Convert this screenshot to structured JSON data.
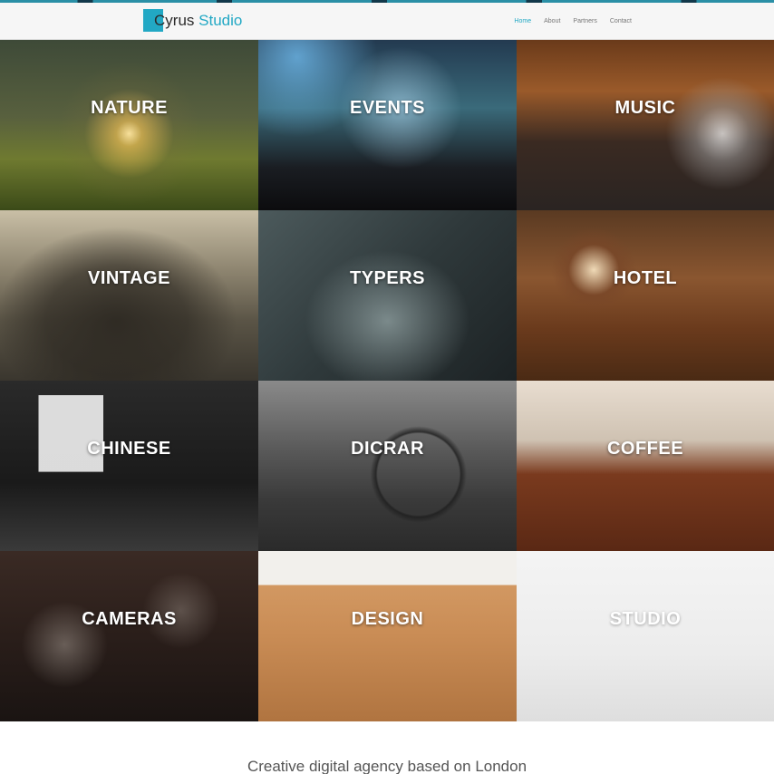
{
  "brand": {
    "name_first": "Cyrus",
    "name_second": "Studio",
    "accent_color": "#22a8c4"
  },
  "nav": {
    "items": [
      {
        "label": "Home",
        "active": true
      },
      {
        "label": "About",
        "active": false
      },
      {
        "label": "Partners",
        "active": false
      },
      {
        "label": "Contact",
        "active": false
      }
    ]
  },
  "portfolio": {
    "tiles": [
      {
        "label": "NATURE"
      },
      {
        "label": "EVENTS"
      },
      {
        "label": "MUSIC"
      },
      {
        "label": "VINTAGE"
      },
      {
        "label": "TYPERS"
      },
      {
        "label": "HOTEL"
      },
      {
        "label": "CHINESE"
      },
      {
        "label": "DICRAR"
      },
      {
        "label": "COFFEE"
      },
      {
        "label": "CAMERAS"
      },
      {
        "label": "DESIGN"
      },
      {
        "label": "STUDIO"
      }
    ]
  },
  "tagline": "Creative digital agency based on London"
}
